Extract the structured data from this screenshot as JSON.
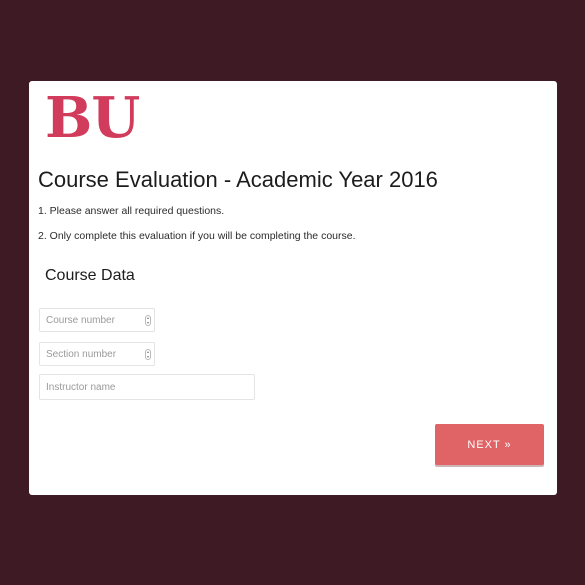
{
  "logo": {
    "text": "BU",
    "color": "#d23c5c"
  },
  "page": {
    "title": "Course Evaluation - Academic Year 2016",
    "instructions": [
      "1. Please answer all required questions.",
      "2. Only complete this evaluation if you will be completing the course."
    ]
  },
  "form": {
    "section_title": "Course Data",
    "fields": {
      "course_number": {
        "placeholder": "Course number",
        "value": ""
      },
      "section_number": {
        "placeholder": "Section number",
        "value": ""
      },
      "instructor_name": {
        "placeholder": "Instructor name",
        "value": ""
      }
    },
    "next_label": "NEXT »"
  },
  "colors": {
    "background": "#3d1a24",
    "card": "#ffffff",
    "accent": "#e06366"
  }
}
